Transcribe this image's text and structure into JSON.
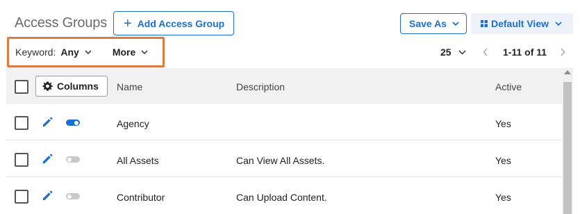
{
  "header": {
    "title": "Access Groups",
    "add_label": "Add Access Group",
    "save_as_label": "Save As",
    "view_label": "Default View"
  },
  "filters": {
    "keyword_label": "Keyword:",
    "keyword_value": "Any",
    "more_label": "More"
  },
  "pagination": {
    "per_page": "25",
    "range": "1-11 of 11"
  },
  "table": {
    "columns_button": "Columns",
    "headers": [
      "Name",
      "Description",
      "Active"
    ],
    "rows": [
      {
        "name": "Agency",
        "description": "",
        "active": "Yes",
        "toggle_on": true
      },
      {
        "name": "All Assets",
        "description": "Can View All Assets.",
        "active": "Yes",
        "toggle_on": false
      },
      {
        "name": "Contributor",
        "description": "Can Upload Content.",
        "active": "Yes",
        "toggle_on": false
      }
    ]
  },
  "colors": {
    "accent": "#1a6fd1",
    "highlight_border": "#e07b3e",
    "toggle_on": "#1a6fd1",
    "toggle_off": "#c8c8c8"
  },
  "icons": [
    "plus-icon",
    "chevron-down-icon",
    "grid-icon",
    "gear-icon",
    "chevron-left-icon",
    "chevron-right-icon",
    "pencil-icon",
    "toggle-icon"
  ]
}
